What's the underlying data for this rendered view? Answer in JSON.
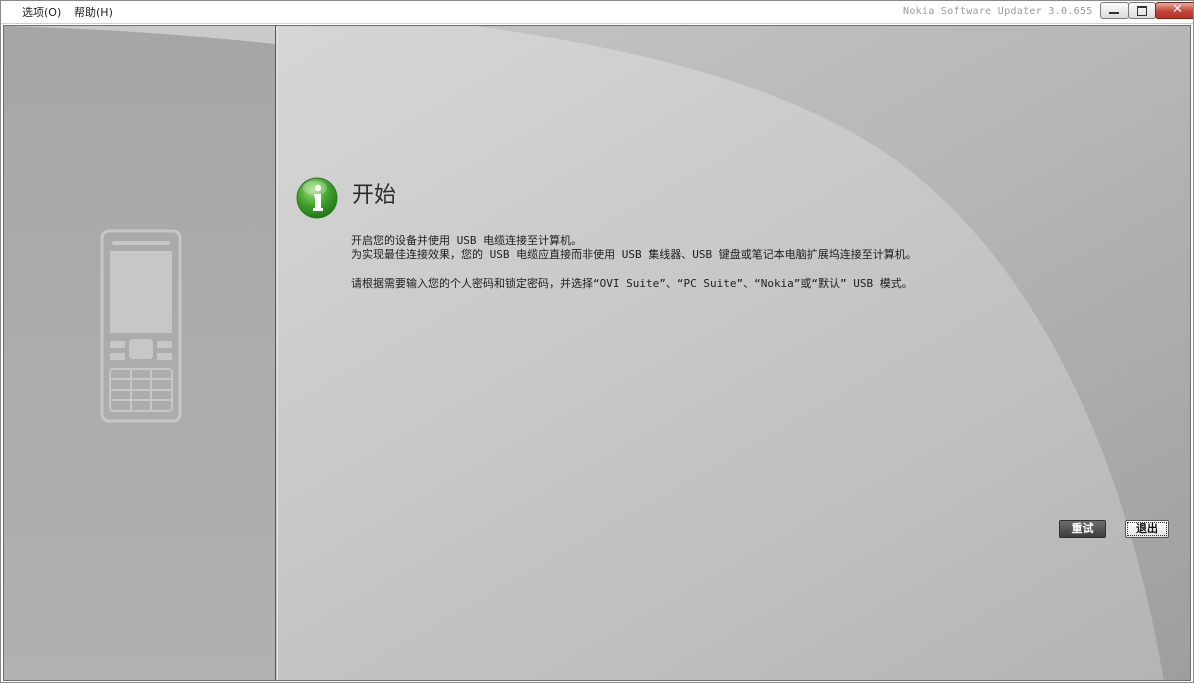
{
  "menu": {
    "options": "选项(O)",
    "help": "帮助(H)"
  },
  "window": {
    "title": "Nokia Software Updater 3.0.655",
    "minimize_icon": "minimize-icon",
    "maximize_icon": "maximize-icon",
    "close_label": "✕"
  },
  "colors": {
    "background_gray": "#bdbdbd",
    "left_panel_gray": "#a9a9a9",
    "info_green": "#3fa12c"
  },
  "main": {
    "heading": "开始",
    "icon": "info-icon",
    "lines": [
      "开启您的设备并使用 USB 电缆连接至计算机。",
      "为实现最佳连接效果，您的 USB 电缆应直接而非使用 USB 集线器、USB 键盘或笔记本电脑扩展坞连接至计算机。",
      "请根据需要输入您的个人密码和锁定密码，并选择“OVI Suite”、“PC Suite”、“Nokia”或“默认” USB 模式。"
    ]
  },
  "sidebar": {
    "icon": "phone-icon"
  },
  "buttons": {
    "retry": "重试",
    "exit": "退出"
  }
}
